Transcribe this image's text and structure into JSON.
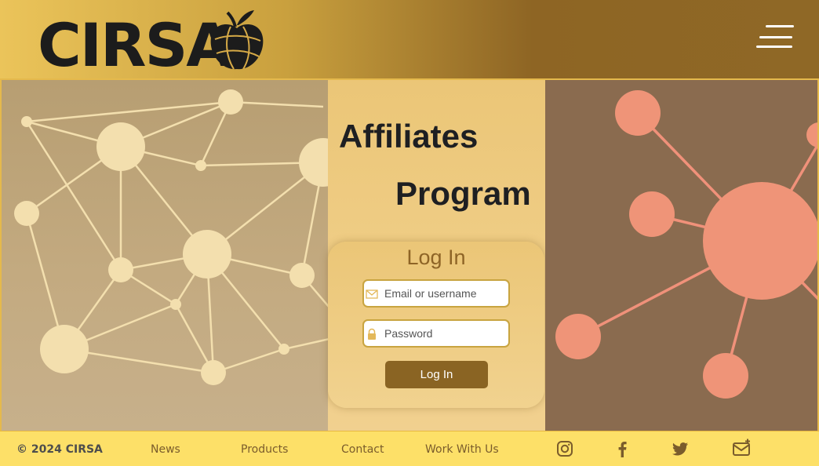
{
  "header": {
    "logo_text": "CIRSA",
    "menu_icon": "hamburger-menu-icon"
  },
  "hero": {
    "title_line1": "Affiliates",
    "title_line2": "Program"
  },
  "login": {
    "title": "Log In",
    "email_placeholder": "Email or username",
    "email_icon": "envelope-icon",
    "password_placeholder": "Password",
    "password_icon": "lock-icon",
    "submit_label": "Log In"
  },
  "footer": {
    "copyright": "© 2024 CIRSA",
    "links": [
      "News",
      "Products",
      "Contact",
      "Work With Us"
    ],
    "social_icons": [
      "instagram-icon",
      "facebook-icon",
      "twitter-icon",
      "mail-plus-icon"
    ]
  },
  "colors": {
    "accent": "#8a6423",
    "footer_bg": "#fde068",
    "header_gold": "#ebc45a",
    "title_text": "#1e1f22"
  }
}
